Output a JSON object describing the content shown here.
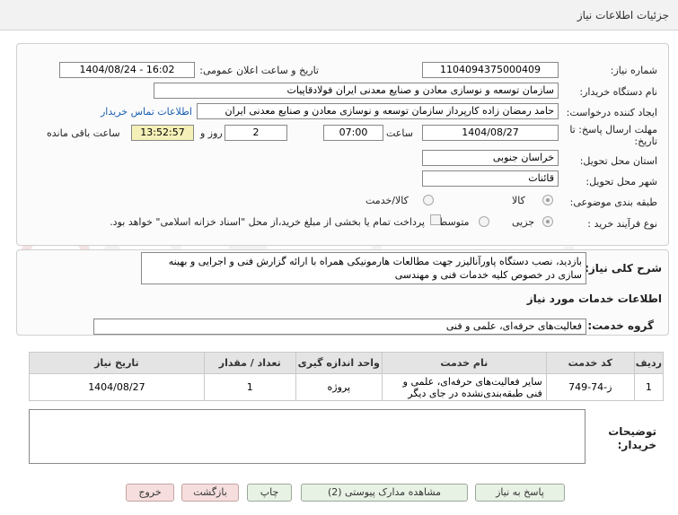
{
  "header": {
    "title": "جزئیات اطلاعات نیاز"
  },
  "need": {
    "number_label": "شماره نیاز:",
    "number_value": "1104094375000409",
    "announce_label": "تاریخ و ساعت اعلان عمومی:",
    "announce_value": "1404/08/24 - 16:02",
    "buyer_label": "نام دستگاه خریدار:",
    "buyer_value": "سازمان توسعه و نوسازی معادن و صنایع معدنی ایران فولادقاپیات",
    "creator_label": "ایجاد کننده درخواست:",
    "creator_value": "حامد  رمضان زاده  کارپرداز  سازمان توسعه و نوسازی معادن و صنایع معدنی ایران",
    "contact_link": "اطلاعات تماس خریدار",
    "deadline_label": "مهلت ارسال پاسخ: تا تاریخ:",
    "deadline_date": "1404/08/27",
    "time_label": "ساعت",
    "deadline_time": "07:00",
    "days_value": "2",
    "days_label": "روز و",
    "remaining_value": "13:52:57",
    "remaining_label": "ساعت باقی مانده",
    "province_label": "استان محل تحویل:",
    "province_value": "خراسان جنوبی",
    "city_label": "شهر محل تحویل:",
    "city_value": "قائنات",
    "category_label": "طبقه بندی موضوعی:",
    "category_options": [
      "کالا",
      "کالا/خدمت"
    ],
    "process_label": "نوع فرآیند خرید :",
    "process_options": [
      "جزیی",
      "متوسط"
    ],
    "payment_note": "پرداخت تمام یا بخشی از مبلغ خرید،از محل \"اسناد خزانه اسلامی\" خواهد بود."
  },
  "description": {
    "label": "شرح کلی نیاز:",
    "value": "بازدید، نصب دستگاه پاورآنالیزر جهت مطالعات هارمونیکی همراه با ارائه گزارش فنی و اجرایی و بهینه سازی در خصوص کلیه خدمات فنی و مهندسی"
  },
  "services": {
    "section_title": "اطلاعات خدمات مورد نیاز",
    "group_label": "گروه خدمت:",
    "group_value": "فعالیت‌های حرفه‌ای، علمی و فنی"
  },
  "table": {
    "headers": [
      "ردیف",
      "کد خدمت",
      "نام خدمت",
      "واحد اندازه گیری",
      "تعداد / مقدار",
      "تاریخ نیاز"
    ],
    "rows": [
      [
        "1",
        "ز-74-749",
        "سایر فعالیت‌های حرفه‌ای، علمی و فنی طبقه‌بندی‌نشده در جای دیگر",
        "پروژه",
        "1",
        "1404/08/27"
      ]
    ]
  },
  "notes": {
    "label": "توضیحات خریدار:"
  },
  "buttons": {
    "reply": "پاسخ به نیاز",
    "attachments": "مشاهده مدارک پیوستی (2)",
    "print": "چاپ",
    "back": "بازگشت",
    "exit": "خروج"
  },
  "watermark": {
    "text": "AriaTender.net"
  },
  "colors": {
    "link": "#1a5fb4",
    "remaining_bg": "#f5f0b8",
    "button_bg": "#e8f2e4",
    "button_pink": "#f6dede"
  }
}
